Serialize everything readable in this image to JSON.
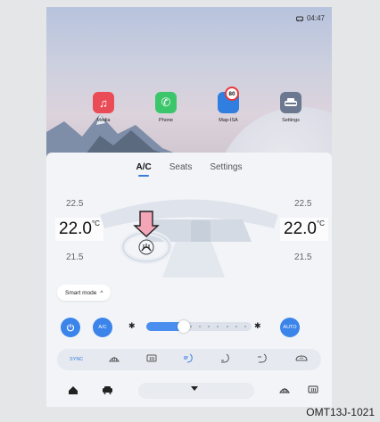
{
  "status_bar": {
    "icon": "car-link-icon",
    "time": "04:47"
  },
  "home_apps": [
    {
      "label": "Media",
      "icon": "music-note-icon",
      "color": "#e94c56"
    },
    {
      "label": "Phone",
      "icon": "phone-icon",
      "color": "#3cc66c"
    },
    {
      "label": "Map-ISA",
      "icon": "map-icon",
      "color": "#2f7ee0",
      "badge": "80"
    },
    {
      "label": "Settings",
      "icon": "settings-car-icon",
      "color": "#6b7890"
    }
  ],
  "climate": {
    "tabs": [
      {
        "label": "A/C",
        "active": true
      },
      {
        "label": "Seats"
      },
      {
        "label": "Settings"
      }
    ],
    "left_temp": {
      "upper": "22.5",
      "current": "22.0",
      "unit": "°C",
      "lower": "21.5"
    },
    "right_temp": {
      "upper": "22.5",
      "current": "22.0",
      "unit": "°C",
      "lower": "21.5"
    },
    "smart_mode_label": "Smart mode",
    "power_icon": "power-icon",
    "ac_label": "A/C",
    "auto_label": "AUTO",
    "fan_level_fraction": 0.36,
    "bottom_bar": {
      "sync_label": "SYNC",
      "icons": [
        "front-defrost-icon",
        "rear-defrost-icon",
        "air-face-icon",
        "air-feet-icon",
        "air-face-feet-icon",
        "recirculation-icon"
      ]
    }
  },
  "nav_bar": {
    "icons": [
      "home-icon",
      "car-icon",
      "chevron-down-icon",
      "front-defrost-icon",
      "rear-defrost-icon"
    ]
  },
  "accent_color": "#3a7be0",
  "image_caption": "OMT13J-1021"
}
